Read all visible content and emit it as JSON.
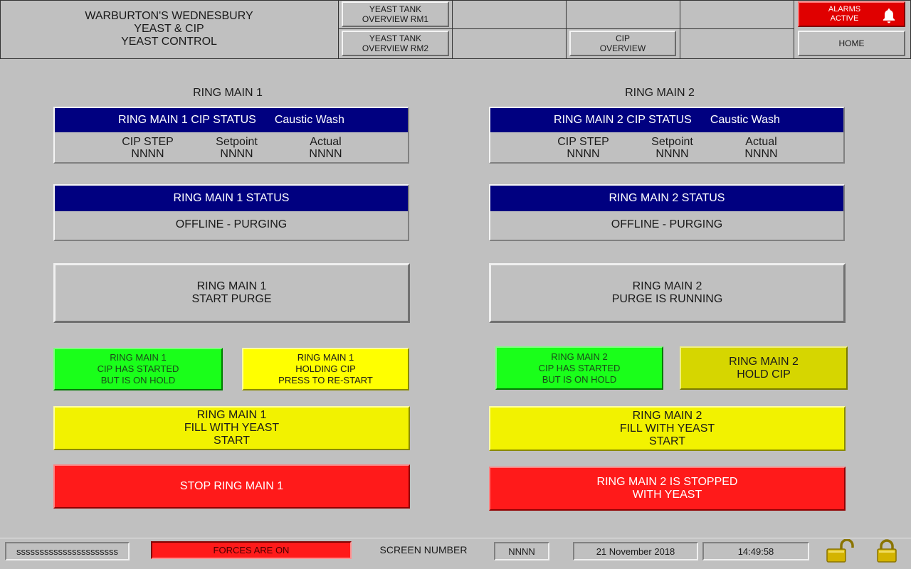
{
  "header": {
    "title_line1": "WARBURTON'S WEDNESBURY",
    "title_line2": "YEAST & CIP",
    "title_line3": "YEAST CONTROL",
    "nav": {
      "yeast_rm1_l1": "YEAST TANK",
      "yeast_rm1_l2": "OVERVIEW RM1",
      "yeast_rm2_l1": "YEAST TANK",
      "yeast_rm2_l2": "OVERVIEW RM2",
      "cip_l1": "CIP",
      "cip_l2": "OVERVIEW",
      "home": "HOME"
    },
    "alarm_l1": "ALARMS",
    "alarm_l2": "ACTIVE",
    "alarm_icon": "bell-icon",
    "alarm_color": "#e00000"
  },
  "ring_main_1": {
    "title": "RING MAIN 1",
    "cip_status_label": "RING MAIN 1 CIP STATUS",
    "cip_status_value": "Caustic Wash",
    "cip_step_label": "CIP STEP",
    "setpoint_label": "Setpoint",
    "actual_label": "Actual",
    "cip_step_value": "NNNN",
    "setpoint_value": "NNNN",
    "actual_value": "NNNN",
    "status_label": "RING MAIN 1 STATUS",
    "status_value": "OFFLINE - PURGING",
    "purge_l1": "RING MAIN 1",
    "purge_l2": "START PURGE",
    "cip_started_l1": "RING MAIN 1",
    "cip_started_l2": "CIP HAS STARTED",
    "cip_started_l3": "BUT IS ON HOLD",
    "hold_l1": "RING MAIN 1",
    "hold_l2": "HOLDING CIP",
    "hold_l3": "PRESS TO RE-START",
    "fill_l1": "RING MAIN 1",
    "fill_l2": "FILL WITH YEAST",
    "fill_l3": "START",
    "stop_l1": "STOP RING MAIN 1",
    "stop_l2": ""
  },
  "ring_main_2": {
    "title": "RING MAIN 2",
    "cip_status_label": "RING MAIN 2 CIP STATUS",
    "cip_status_value": "Caustic Wash",
    "cip_step_label": "CIP STEP",
    "setpoint_label": "Setpoint",
    "actual_label": "Actual",
    "cip_step_value": "NNNN",
    "setpoint_value": "NNNN",
    "actual_value": "NNNN",
    "status_label": "RING MAIN 2 STATUS",
    "status_value": "OFFLINE - PURGING",
    "purge_l1": "RING MAIN 2",
    "purge_l2": "PURGE IS RUNNING",
    "cip_started_l1": "RING MAIN 2",
    "cip_started_l2": "CIP HAS STARTED",
    "cip_started_l3": "BUT IS ON HOLD",
    "hold_l1": "RING MAIN 2",
    "hold_l2": "HOLD CIP",
    "hold_l3": "",
    "fill_l1": "RING MAIN 2",
    "fill_l2": "FILL WITH YEAST",
    "fill_l3": "START",
    "stop_l1": "RING MAIN 2 IS STOPPED",
    "stop_l2": "WITH YEAST"
  },
  "footer": {
    "user_field": "ssssssssssssssssssssss",
    "forces": "FORCES ARE ON",
    "screen_number_label": "SCREEN NUMBER",
    "screen_number_value": "NNNN",
    "date": "21 November 2018",
    "time": "14:49:58",
    "unlock_icon": "unlocked-padlock-icon",
    "lock_icon": "locked-padlock-icon"
  },
  "colors": {
    "background": "#c0c0c0",
    "status_bar_blue": "#000080",
    "green_status": "#1aff1a",
    "yellow_action": "#ffff00",
    "red_stop": "#ff1a1a",
    "padlock_gold": "#d4b400"
  }
}
